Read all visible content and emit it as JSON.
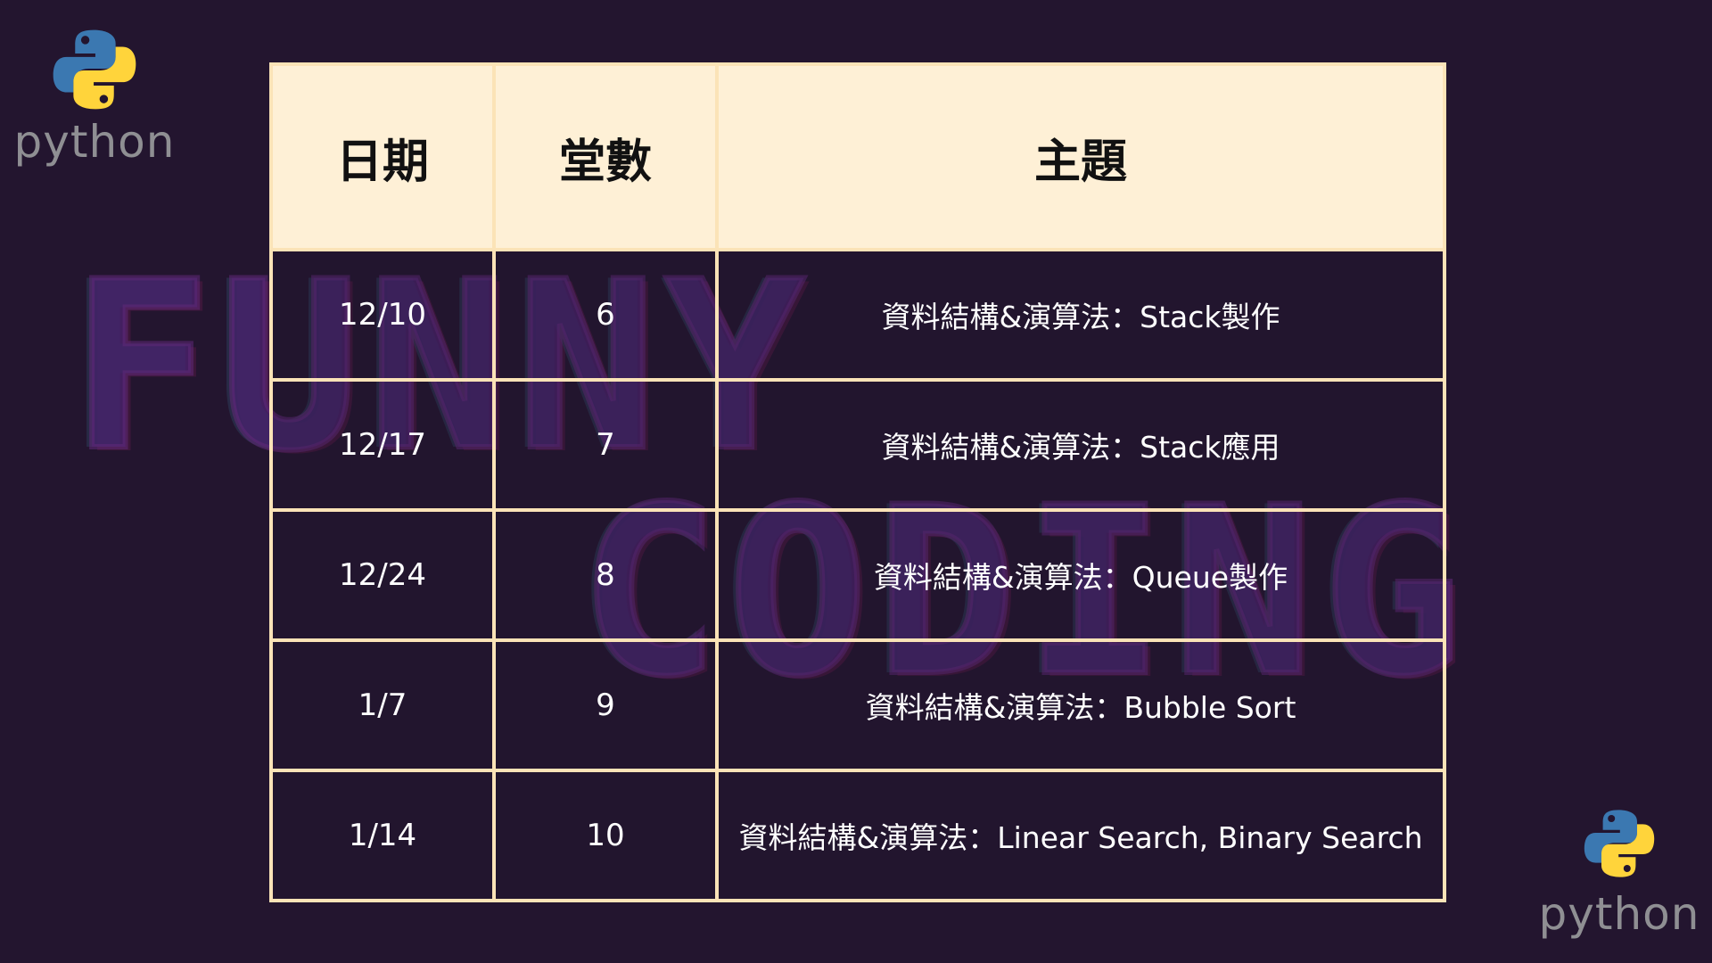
{
  "branding": {
    "logo_word": "python",
    "logo_colors": {
      "blue": "#3b78b1",
      "yellow": "#ffd43b",
      "text": "#8f8f93"
    },
    "watermark_line1": "FUNNY",
    "watermark_line2": "CODING"
  },
  "colors": {
    "background": "#23152f",
    "header_fill": "#fef0d6",
    "grid_line": "#fbe3b7"
  },
  "table": {
    "headers": [
      "日期",
      "堂數",
      "主題"
    ],
    "rows": [
      {
        "date": "12/10",
        "lesson": "6",
        "topic": "資料結構&演算法：Stack製作"
      },
      {
        "date": "12/17",
        "lesson": "7",
        "topic": "資料結構&演算法：Stack應用"
      },
      {
        "date": "12/24",
        "lesson": "8",
        "topic": "資料結構&演算法：Queue製作"
      },
      {
        "date": "1/7",
        "lesson": "9",
        "topic": "資料結構&演算法：Bubble Sort"
      },
      {
        "date": "1/14",
        "lesson": "10",
        "topic": "資料結構&演算法：Linear Search, Binary Search"
      }
    ]
  }
}
